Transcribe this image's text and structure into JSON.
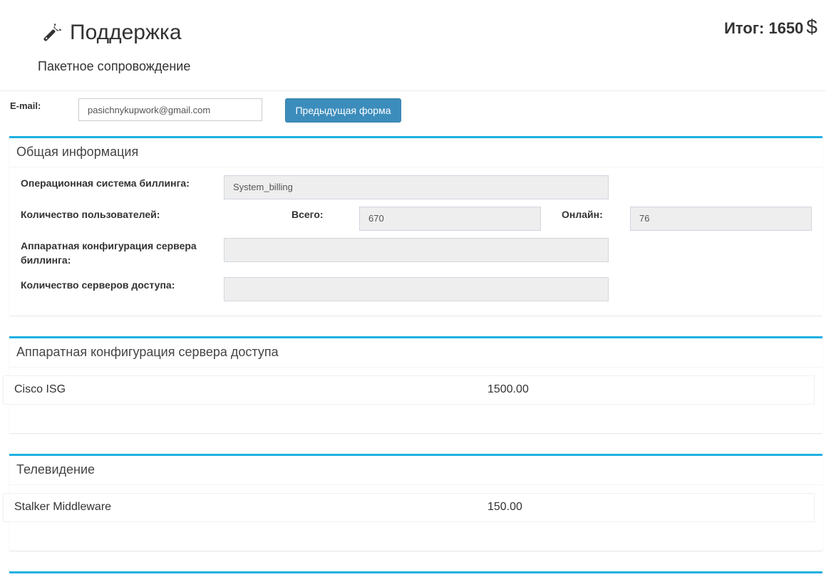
{
  "header": {
    "title": "Поддержка",
    "subtitle": "Пакетное сопровождение",
    "total_label": "Итог:",
    "total_value": "1650",
    "currency": "$",
    "icon": "wrench-icon"
  },
  "email": {
    "label": "E-mail:",
    "value": "pasichnykupwork@gmail.com"
  },
  "buttons": {
    "prev_form": "Предыдущая форма"
  },
  "general": {
    "title": "Общая информация",
    "billing_os_label": "Операционная система биллинга:",
    "billing_os_value": "System_billing",
    "users_label": "Количество пользователей:",
    "total_users_label": "Всего:",
    "total_users_value": "670",
    "online_label": "Онлайн:",
    "online_value": "76",
    "billing_hw_label": "Аппаратная конфигурация сервера биллинга:",
    "billing_hw_value": "",
    "access_servers_label": "Количество серверов доступа:",
    "access_servers_value": ""
  },
  "access_hw": {
    "title": "Аппаратная конфигурация сервера доступа",
    "items": [
      {
        "name": "Cisco ISG",
        "price": "1500.00"
      }
    ]
  },
  "tv": {
    "title": "Телевидение",
    "items": [
      {
        "name": "Stalker Middleware",
        "price": "150.00"
      }
    ]
  },
  "colors": {
    "accent": "#1fb0e0",
    "button": "#3c8dbc",
    "readonly_bg": "#eeeeee"
  }
}
